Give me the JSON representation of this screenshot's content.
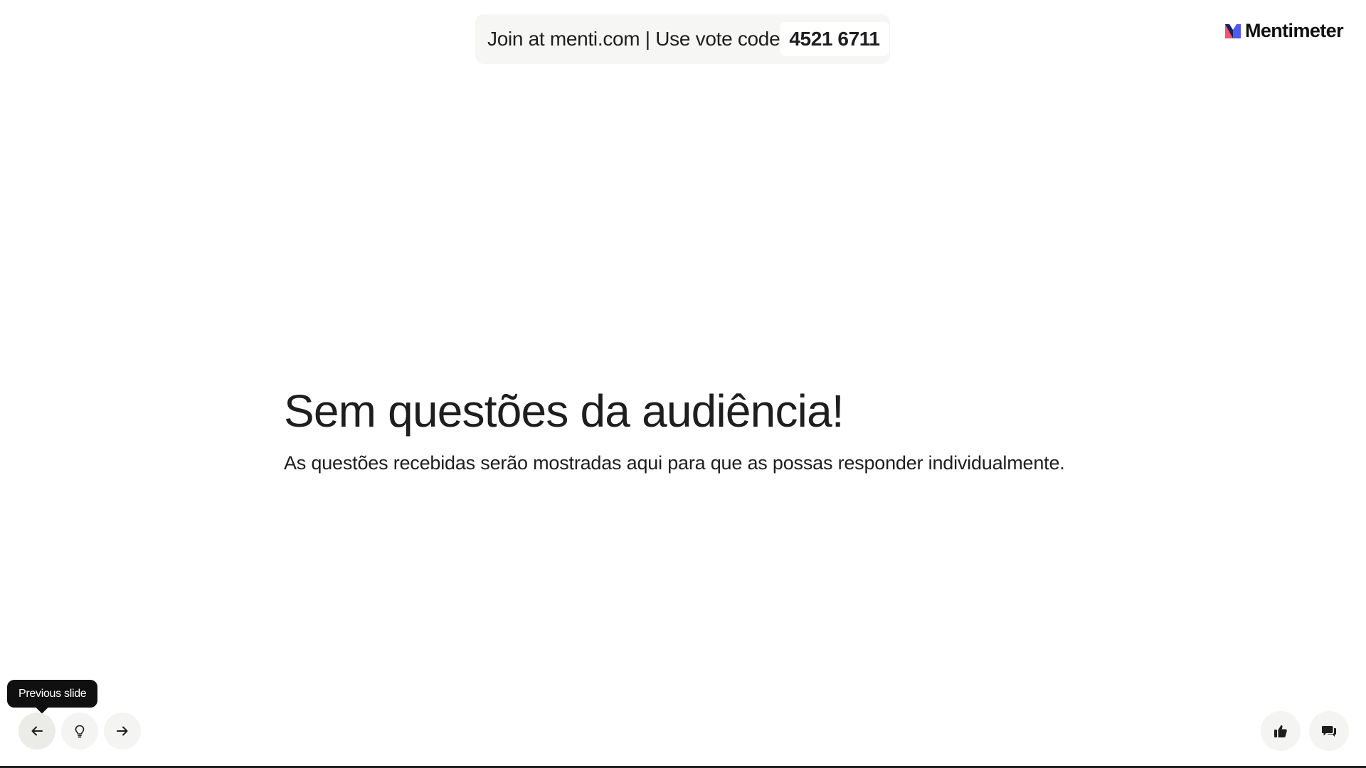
{
  "banner": {
    "join_text": "Join at menti.com | Use vote code",
    "vote_code": "4521 6711"
  },
  "logo": {
    "wordmark": "Mentimeter"
  },
  "slide": {
    "title": "Sem questões da audiência!",
    "subtitle": "As questões recebidas serão mostradas aqui para que as possas responder individualmente."
  },
  "controls": {
    "tooltip": "Previous slide",
    "prev_icon": "arrow-left-icon",
    "tip_icon": "lightbulb-icon",
    "next_icon": "arrow-right-icon",
    "like_icon": "thumbs-up-icon",
    "qa_icon": "chat-bubbles-icon"
  },
  "colors": {
    "text": "#1e1e1e",
    "banner_bg": "#f6f6f4",
    "button_bg": "#f4f4f2",
    "tooltip_bg": "#101010",
    "logo_blue": "#4e5bf0",
    "logo_red": "#f5556b",
    "logo_navy": "#1b1f5c"
  }
}
